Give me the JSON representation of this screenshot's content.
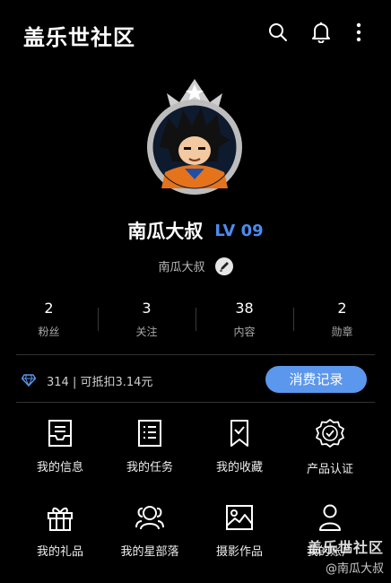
{
  "header": {
    "app_title": "盖乐世社区"
  },
  "profile": {
    "nickname": "南瓜大叔",
    "level": "LV 09",
    "sub_name": "南瓜大叔"
  },
  "stats": [
    {
      "value": "2",
      "label": "粉丝"
    },
    {
      "value": "3",
      "label": "关注"
    },
    {
      "value": "38",
      "label": "内容"
    },
    {
      "value": "2",
      "label": "勋章"
    }
  ],
  "wallet": {
    "text": "314 | 可抵扣3.14元",
    "button_label": "消费记录"
  },
  "menu": [
    {
      "label": "我的信息",
      "icon": "inbox-icon"
    },
    {
      "label": "我的任务",
      "icon": "task-list-icon"
    },
    {
      "label": "我的收藏",
      "icon": "bookmark-icon"
    },
    {
      "label": "产品认证",
      "icon": "certified-badge-icon"
    },
    {
      "label": "我的礼品",
      "icon": "gift-icon"
    },
    {
      "label": "我的星部落",
      "icon": "tribe-icon"
    },
    {
      "label": "摄影作品",
      "icon": "photo-icon"
    },
    {
      "label": "我的账户",
      "icon": "account-icon"
    }
  ],
  "watermark": {
    "title": "盖乐世社区",
    "handle": "@南瓜大叔"
  },
  "colors": {
    "background": "#000000",
    "accent": "#5b97ec",
    "level": "#4c8cf0"
  }
}
